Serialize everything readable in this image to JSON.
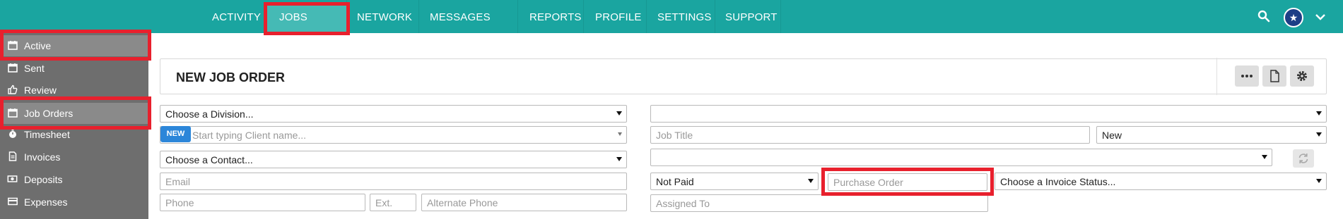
{
  "topnav": {
    "items": [
      {
        "label": "ACTIVITY"
      },
      {
        "label": "JOBS"
      },
      {
        "label": "NETWORK"
      },
      {
        "label": "MESSAGES"
      },
      {
        "label": "REPORTS"
      },
      {
        "label": "PROFILE"
      },
      {
        "label": "SETTINGS"
      },
      {
        "label": "SUPPORT"
      }
    ],
    "active": "JOBS",
    "accent_color": "#1aa5a0",
    "highlight_color": "#e8202d"
  },
  "sidebar": {
    "items": [
      {
        "label": "Active",
        "icon": "calendar-icon"
      },
      {
        "label": "Sent",
        "icon": "calendar-icon"
      },
      {
        "label": "Review",
        "icon": "thumbs-up-icon"
      },
      {
        "label": "Job Orders",
        "icon": "calendar-icon"
      },
      {
        "label": "Timesheet",
        "icon": "stopwatch-icon"
      },
      {
        "label": "Invoices",
        "icon": "document-icon"
      },
      {
        "label": "Deposits",
        "icon": "money-icon"
      },
      {
        "label": "Expenses",
        "icon": "credit-card-icon"
      }
    ]
  },
  "page": {
    "title": "NEW JOB ORDER",
    "toolbar_icons": [
      "more-icon",
      "document-icon",
      "gear-icon"
    ]
  },
  "form": {
    "division_select": "Choose a Division...",
    "new_badge": "NEW",
    "client_placeholder": "Start typing Client name...",
    "contact_select": "Choose a Contact...",
    "email_placeholder": "Email",
    "phone_placeholder": "Phone",
    "ext_placeholder": "Ext.",
    "alt_phone_placeholder": "Alternate Phone",
    "top_right_select": "",
    "job_title_placeholder": "Job Title",
    "status_select": "New",
    "third_right_select": "",
    "payment_select": "Not Paid",
    "purchase_order_placeholder": "Purchase Order",
    "invoice_status_select": "Choose a Invoice Status...",
    "assigned_to_placeholder": "Assigned To"
  }
}
